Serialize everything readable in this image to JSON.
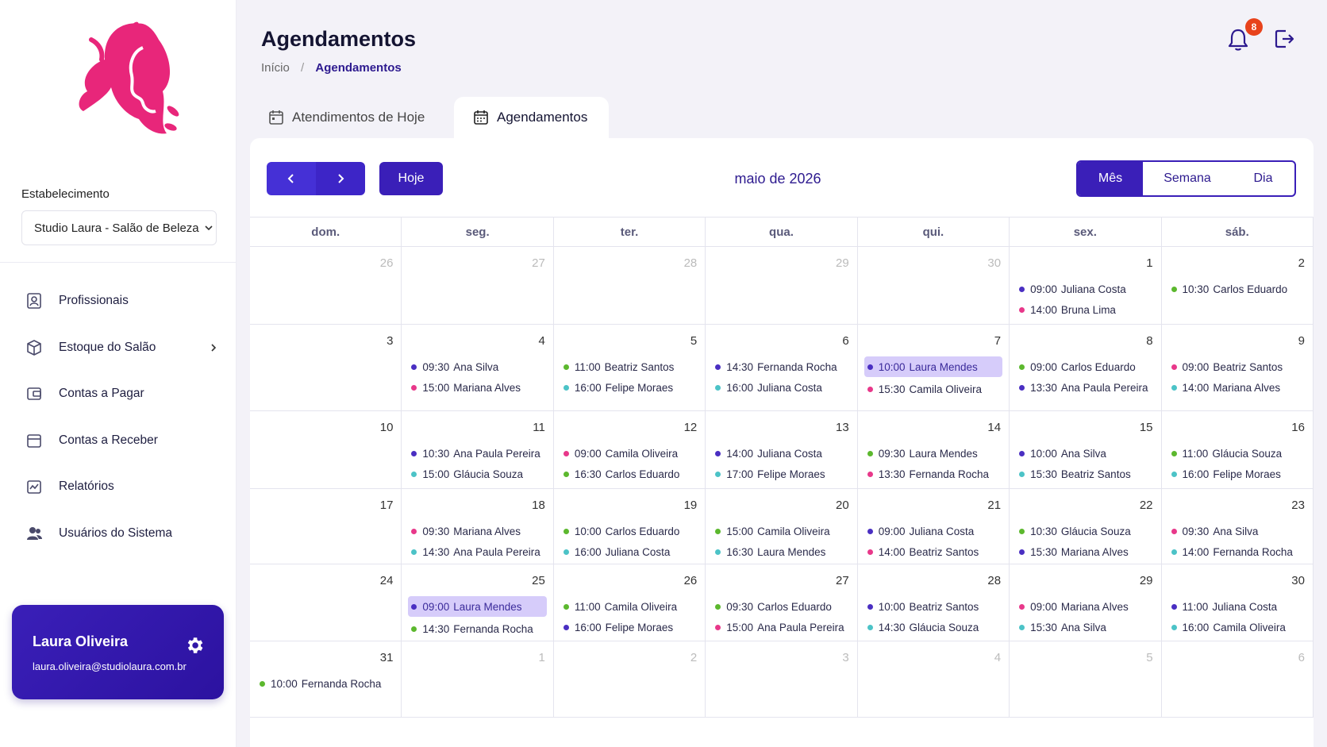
{
  "sidebar": {
    "establishment_label": "Estabelecimento",
    "establishment_value": "Studio Laura - Salão de Beleza",
    "nav": [
      {
        "label": "Profissionais",
        "icon": "professional-badge-icon"
      },
      {
        "label": "Estoque do Salão",
        "icon": "box-icon",
        "has_submenu": true
      },
      {
        "label": "Contas a Pagar",
        "icon": "wallet-icon"
      },
      {
        "label": "Contas a Receber",
        "icon": "receivable-icon"
      },
      {
        "label": "Relatórios",
        "icon": "reports-icon"
      },
      {
        "label": "Usuários do Sistema",
        "icon": "users-icon"
      }
    ],
    "user": {
      "name": "Laura Oliveira",
      "email": "laura.oliveira@studiolaura.com.br"
    }
  },
  "header": {
    "title": "Agendamentos",
    "breadcrumb_home": "Início",
    "breadcrumb_sep": "/",
    "breadcrumb_current": "Agendamentos",
    "notification_count": "8"
  },
  "tabs": [
    {
      "label": "Atendimentos de Hoje",
      "active": false
    },
    {
      "label": "Agendamentos",
      "active": true
    }
  ],
  "calendar": {
    "today_label": "Hoje",
    "month_title": "maio de 2026",
    "views": [
      "Mês",
      "Semana",
      "Dia"
    ],
    "active_view": "Mês",
    "weekdays": [
      "dom.",
      "seg.",
      "ter.",
      "qua.",
      "qui.",
      "sex.",
      "sáb."
    ],
    "colors": {
      "purple": "#4a2fc2",
      "pink": "#e8388a",
      "green": "#5cb82e",
      "teal": "#4cc3c7"
    },
    "weeks": [
      [
        {
          "day": "26",
          "other": true,
          "events": []
        },
        {
          "day": "27",
          "other": true,
          "events": []
        },
        {
          "day": "28",
          "other": true,
          "events": []
        },
        {
          "day": "29",
          "other": true,
          "events": []
        },
        {
          "day": "30",
          "other": true,
          "events": []
        },
        {
          "day": "1",
          "events": [
            {
              "time": "09:00",
              "name": "Juliana Costa",
              "color": "purple"
            },
            {
              "time": "14:00",
              "name": "Bruna Lima",
              "color": "pink"
            }
          ]
        },
        {
          "day": "2",
          "events": [
            {
              "time": "10:30",
              "name": "Carlos Eduardo",
              "color": "green"
            }
          ]
        }
      ],
      [
        {
          "day": "3",
          "events": []
        },
        {
          "day": "4",
          "events": [
            {
              "time": "09:30",
              "name": "Ana Silva",
              "color": "purple"
            },
            {
              "time": "15:00",
              "name": "Mariana Alves",
              "color": "pink"
            }
          ]
        },
        {
          "day": "5",
          "events": [
            {
              "time": "11:00",
              "name": "Beatriz Santos",
              "color": "green"
            },
            {
              "time": "16:00",
              "name": "Felipe Moraes",
              "color": "teal"
            }
          ]
        },
        {
          "day": "6",
          "events": [
            {
              "time": "14:30",
              "name": "Fernanda Rocha",
              "color": "purple"
            },
            {
              "time": "16:00",
              "name": "Juliana Costa",
              "color": "teal"
            }
          ]
        },
        {
          "day": "7",
          "events": [
            {
              "time": "10:00",
              "name": "Laura Mendes",
              "color": "purple",
              "highlight": true
            },
            {
              "time": "15:30",
              "name": "Camila Oliveira",
              "color": "pink"
            }
          ]
        },
        {
          "day": "8",
          "events": [
            {
              "time": "09:00",
              "name": "Carlos Eduardo",
              "color": "green"
            },
            {
              "time": "13:30",
              "name": "Ana Paula Pereira",
              "color": "purple"
            }
          ]
        },
        {
          "day": "9",
          "events": [
            {
              "time": "09:00",
              "name": "Beatriz Santos",
              "color": "pink"
            },
            {
              "time": "14:00",
              "name": "Mariana Alves",
              "color": "teal"
            }
          ]
        }
      ],
      [
        {
          "day": "10",
          "events": []
        },
        {
          "day": "11",
          "events": [
            {
              "time": "10:30",
              "name": "Ana Paula Pereira",
              "color": "purple"
            },
            {
              "time": "15:00",
              "name": "Gláucia Souza",
              "color": "teal"
            }
          ]
        },
        {
          "day": "12",
          "events": [
            {
              "time": "09:00",
              "name": "Camila Oliveira",
              "color": "pink"
            },
            {
              "time": "16:30",
              "name": "Carlos Eduardo",
              "color": "green"
            }
          ]
        },
        {
          "day": "13",
          "events": [
            {
              "time": "14:00",
              "name": "Juliana Costa",
              "color": "purple"
            },
            {
              "time": "17:00",
              "name": "Felipe Moraes",
              "color": "teal"
            }
          ]
        },
        {
          "day": "14",
          "events": [
            {
              "time": "09:30",
              "name": "Laura Mendes",
              "color": "green"
            },
            {
              "time": "13:30",
              "name": "Fernanda Rocha",
              "color": "pink"
            }
          ]
        },
        {
          "day": "15",
          "events": [
            {
              "time": "10:00",
              "name": "Ana Silva",
              "color": "purple"
            },
            {
              "time": "15:30",
              "name": "Beatriz Santos",
              "color": "teal"
            }
          ]
        },
        {
          "day": "16",
          "events": [
            {
              "time": "11:00",
              "name": "Gláucia Souza",
              "color": "green"
            },
            {
              "time": "16:00",
              "name": "Felipe Moraes",
              "color": "teal"
            }
          ]
        }
      ],
      [
        {
          "day": "17",
          "events": []
        },
        {
          "day": "18",
          "events": [
            {
              "time": "09:30",
              "name": "Mariana Alves",
              "color": "pink"
            },
            {
              "time": "14:30",
              "name": "Ana Paula Pereira",
              "color": "teal"
            }
          ]
        },
        {
          "day": "19",
          "events": [
            {
              "time": "10:00",
              "name": "Carlos Eduardo",
              "color": "green"
            },
            {
              "time": "16:00",
              "name": "Juliana Costa",
              "color": "teal"
            }
          ]
        },
        {
          "day": "20",
          "events": [
            {
              "time": "15:00",
              "name": "Camila Oliveira",
              "color": "green"
            },
            {
              "time": "16:30",
              "name": "Laura Mendes",
              "color": "teal"
            }
          ]
        },
        {
          "day": "21",
          "events": [
            {
              "time": "09:00",
              "name": "Juliana Costa",
              "color": "purple"
            },
            {
              "time": "14:00",
              "name": "Beatriz Santos",
              "color": "pink"
            }
          ]
        },
        {
          "day": "22",
          "events": [
            {
              "time": "10:30",
              "name": "Gláucia Souza",
              "color": "green"
            },
            {
              "time": "15:30",
              "name": "Mariana Alves",
              "color": "purple"
            }
          ]
        },
        {
          "day": "23",
          "events": [
            {
              "time": "09:30",
              "name": "Ana Silva",
              "color": "pink"
            },
            {
              "time": "14:00",
              "name": "Fernanda Rocha",
              "color": "teal"
            }
          ]
        }
      ],
      [
        {
          "day": "24",
          "events": []
        },
        {
          "day": "25",
          "events": [
            {
              "time": "09:00",
              "name": "Laura Mendes",
              "color": "purple",
              "highlight": true
            },
            {
              "time": "14:30",
              "name": "Fernanda Rocha",
              "color": "green"
            }
          ]
        },
        {
          "day": "26",
          "events": [
            {
              "time": "11:00",
              "name": "Camila Oliveira",
              "color": "green"
            },
            {
              "time": "16:00",
              "name": "Felipe Moraes",
              "color": "purple"
            }
          ]
        },
        {
          "day": "27",
          "events": [
            {
              "time": "09:30",
              "name": "Carlos Eduardo",
              "color": "green"
            },
            {
              "time": "15:00",
              "name": "Ana Paula Pereira",
              "color": "pink"
            }
          ]
        },
        {
          "day": "28",
          "events": [
            {
              "time": "10:00",
              "name": "Beatriz Santos",
              "color": "purple"
            },
            {
              "time": "14:30",
              "name": "Gláucia Souza",
              "color": "teal"
            }
          ]
        },
        {
          "day": "29",
          "events": [
            {
              "time": "09:00",
              "name": "Mariana Alves",
              "color": "pink"
            },
            {
              "time": "15:30",
              "name": "Ana Silva",
              "color": "teal"
            }
          ]
        },
        {
          "day": "30",
          "events": [
            {
              "time": "11:00",
              "name": "Juliana Costa",
              "color": "purple"
            },
            {
              "time": "16:00",
              "name": "Camila Oliveira",
              "color": "teal"
            }
          ]
        }
      ],
      [
        {
          "day": "31",
          "events": [
            {
              "time": "10:00",
              "name": "Fernanda Rocha",
              "color": "green"
            }
          ]
        },
        {
          "day": "1",
          "other": true,
          "events": []
        },
        {
          "day": "2",
          "other": true,
          "events": []
        },
        {
          "day": "3",
          "other": true,
          "events": []
        },
        {
          "day": "4",
          "other": true,
          "events": []
        },
        {
          "day": "5",
          "other": true,
          "events": []
        },
        {
          "day": "6",
          "other": true,
          "events": []
        }
      ]
    ]
  }
}
